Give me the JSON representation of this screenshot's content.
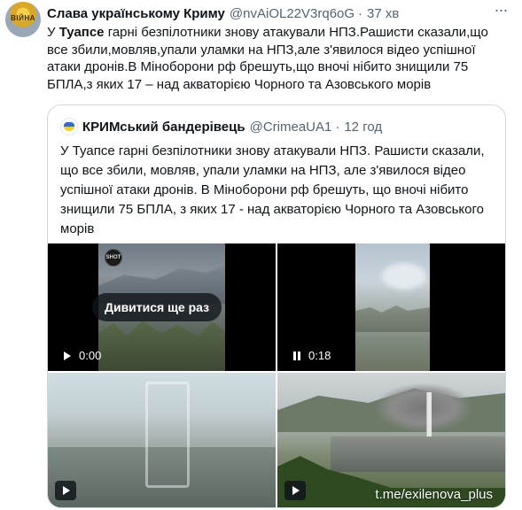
{
  "tweet": {
    "display_name": "Слава українському Криму",
    "handle": "@nvAiOL22V3rq6oG",
    "separator": "·",
    "time": "37 хв",
    "text_prefix": "У ",
    "text_bold": "Туапсе",
    "text_rest": " гарні безпілотники знову атакували НПЗ.Рашисти сказали,що все збили,мовляв,упали уламки на НПЗ,але з'явилося відео успішної атаки дронів.В Міноборони рф брешуть,що вночі нібито знищили 75 БПЛА,з яких 17 – над акваторією Чорного та Азовського морів",
    "more_icon": "more-horizontal-icon"
  },
  "quote": {
    "display_name": "КРИМський бандерівець",
    "handle": "@CrimeaUA1",
    "separator": "·",
    "time": "12 год",
    "text": "У Туапсе гарні безпілотники знову атакували НПЗ. Рашисти сказали, що все збили, мовляв, упали уламки на НПЗ, але з'явилося відео успішної атаки дронів. В Міноборони рф брешуть, що вночі нібито знищили 75 БПЛА, з яких 17 - над акваторією Чорного та Азовського морів"
  },
  "media": {
    "video1": {
      "replay_label": "Дивитися ще раз",
      "time": "0:00",
      "badge": "SHOT",
      "state": "play-icon"
    },
    "video2": {
      "time": "0:18",
      "state": "pause-icon"
    },
    "video3": {
      "state": "play-icon"
    },
    "video4": {
      "state": "play-icon",
      "watermark": "t.me/exilenova_plus"
    }
  },
  "colors": {
    "text_primary": "#0f1419",
    "text_secondary": "#536471",
    "border": "#cfd9de"
  }
}
